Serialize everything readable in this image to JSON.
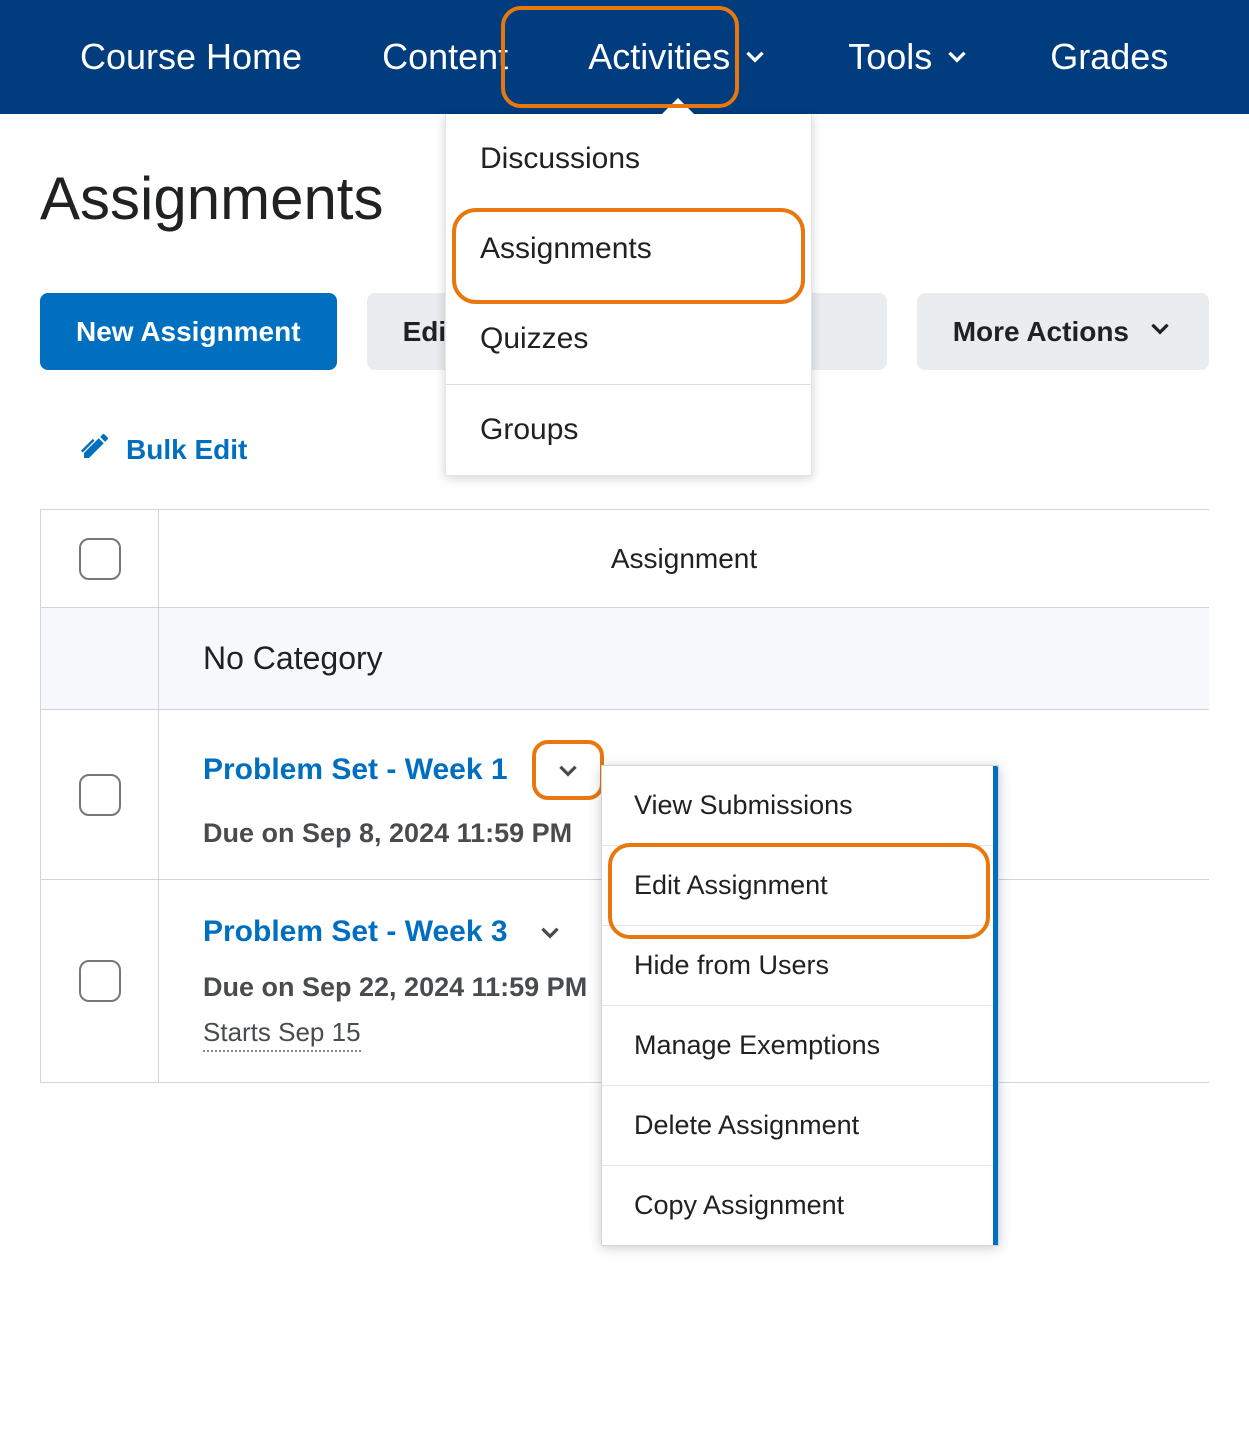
{
  "nav": {
    "course_home": "Course Home",
    "content": "Content",
    "activities": "Activities",
    "tools": "Tools",
    "grades": "Grades"
  },
  "activities_menu": {
    "discussions": "Discussions",
    "assignments": "Assignments",
    "quizzes": "Quizzes",
    "groups": "Groups"
  },
  "page_title": "Assignments",
  "toolbar": {
    "new_assignment": "New Assignment",
    "edit_categories": "Edit Categories",
    "more_actions": "More Actions"
  },
  "bulk_edit": "Bulk Edit",
  "table": {
    "header": "Assignment",
    "category": "No Category",
    "rows": [
      {
        "title": "Problem Set - Week 1",
        "due": "Due on Sep 8, 2024 11:59 PM",
        "starts": ""
      },
      {
        "title": "Problem Set - Week 3",
        "due": "Due on Sep 22, 2024 11:59 PM",
        "starts": "Starts Sep 15"
      }
    ]
  },
  "context_menu": {
    "view_submissions": "View Submissions",
    "edit_assignment": "Edit Assignment",
    "hide_from_users": "Hide from Users",
    "manage_exemptions": "Manage Exemptions",
    "delete_assignment": "Delete Assignment",
    "copy_assignment": "Copy Assignment"
  }
}
